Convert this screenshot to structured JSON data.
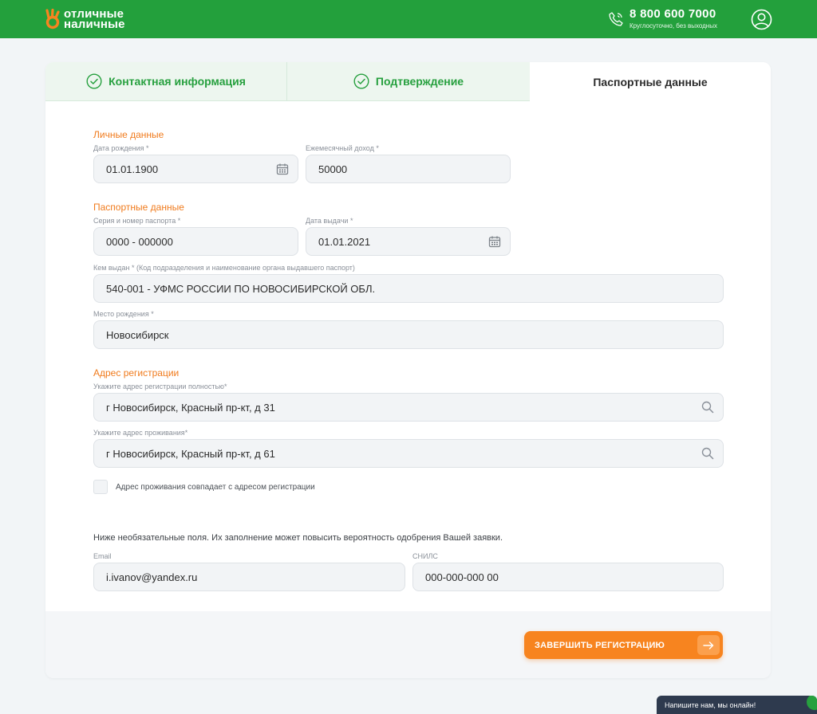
{
  "header": {
    "logo_line1": "отличные",
    "logo_line2": "наличные",
    "phone": "8 800 600 7000",
    "phone_note": "Круглосуточно, без выходных"
  },
  "tabs": [
    {
      "label": "Контактная информация",
      "status": "done"
    },
    {
      "label": "Подтверждение",
      "status": "done"
    },
    {
      "label": "Паспортные данные",
      "status": "active"
    }
  ],
  "personal": {
    "title": "Личные данные",
    "birth_label": "Дата рождения",
    "birth_value": "01.01.1900",
    "income_label": "Ежемесячный доход",
    "income_value": "50000"
  },
  "passport": {
    "title": "Паспортные данные",
    "number_label": "Серия и номер паспорта",
    "number_value": "0000 - 000000",
    "issue_date_label": "Дата выдачи",
    "issue_date_value": "01.01.2021",
    "issued_by_label": "Кем выдан",
    "issued_by_hint": "(Код подразделения и наименование органа выдавшего паспорт)",
    "issued_by_value": "540-001 - УФМС РОССИИ ПО НОВОСИБИРСКОЙ ОБЛ.",
    "birthplace_label": "Место рождения",
    "birthplace_value": "Новосибирск"
  },
  "address": {
    "title": "Адрес регистрации",
    "reg_label": "Укажите адрес регистрации полностью",
    "reg_value": "г Новосибирск, Красный пр-кт, д 31",
    "live_label": "Укажите адрес проживания",
    "live_value": "г Новосибирск, Красный пр-кт, д 61",
    "same_label": "Адрес проживания совпадает с адресом регистрации"
  },
  "optional": {
    "note": "Ниже необязательные поля. Их заполнение может повысить вероятность одобрения Вашей заявки.",
    "email_label": "Email",
    "email_value": "i.ivanov@yandex.ru",
    "snils_label": "СНИЛС",
    "snils_value": "000-000-000 00"
  },
  "submit_label": "ЗАВЕРШИТЬ РЕГИСТРАЦИЮ",
  "chat_label": "Напишите нам, мы онлайн!",
  "colors": {
    "brand_green": "#23a03c",
    "accent_orange": "#f7841f",
    "section_orange": "#f07b1d"
  }
}
